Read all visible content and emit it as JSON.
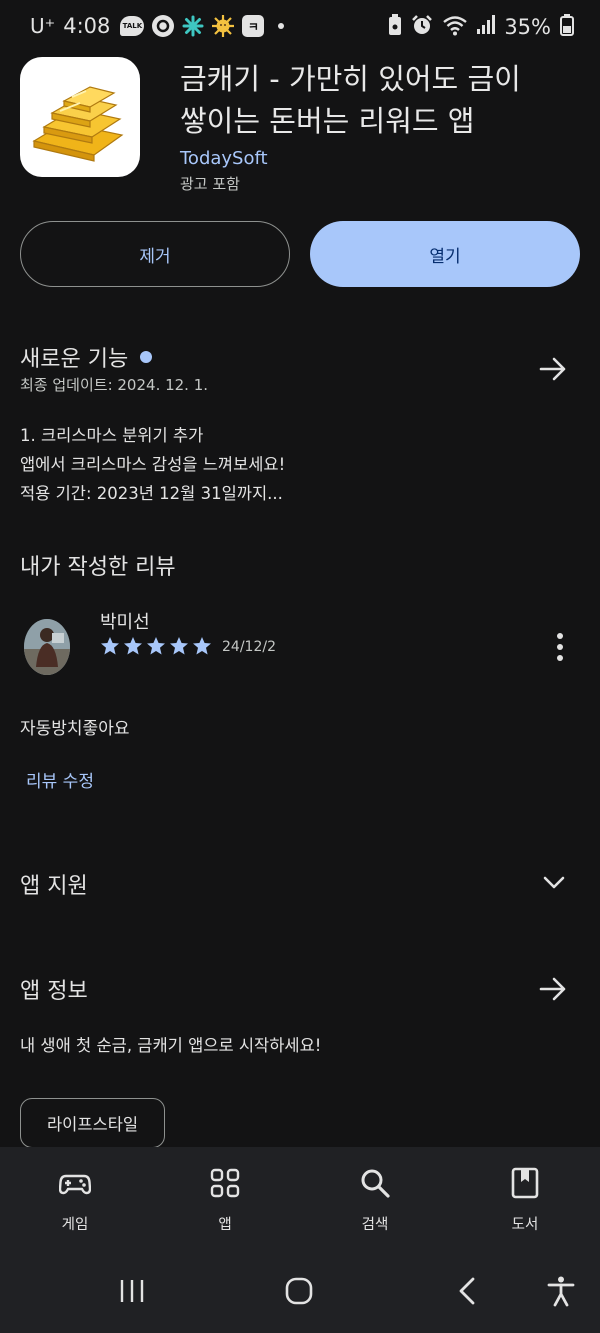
{
  "status_bar": {
    "carrier": "U⁺",
    "time": "4:08",
    "battery": "35%",
    "notification_icons": [
      "talk-icon",
      "q-app-icon",
      "teal-star-icon",
      "sun-face-icon",
      "k-app-icon",
      "dot-icon"
    ],
    "system_icons": [
      "lock-battery-icon",
      "alarm-icon",
      "wifi-icon",
      "signal-icon",
      "battery-icon"
    ]
  },
  "app": {
    "title_line1": "금캐기 - 가만히 있어도 금이",
    "title_line2": "쌓이는 돈버는 리워드 앱",
    "developer": "TodaySoft",
    "ads_label": "광고 포함",
    "icon": "gold-bars-icon"
  },
  "actions": {
    "remove_label": "제거",
    "open_label": "열기"
  },
  "whats_new": {
    "title": "새로운 기능",
    "updated": "최종 업데이트: 2024. 12. 1.",
    "notes": [
      "1. 크리스마스 분위기 추가",
      "앱에서 크리스마스 감성을 느껴보세요!",
      "적용 기간: 2023년 12월 31일까지..."
    ]
  },
  "my_review": {
    "title": "내가 작성한 리뷰",
    "reviewer": "박미선",
    "rating": 5,
    "date": "24/12/2",
    "text": "자동방치좋아요",
    "edit_label": "리뷰 수정"
  },
  "app_support": {
    "title": "앱 지원"
  },
  "about": {
    "title": "앱 정보",
    "description": "내 생애 첫 순금, 금캐기 앱으로 시작하세요!",
    "category_chip": "라이프스타일"
  },
  "bottom_nav": {
    "items": [
      {
        "label": "게임",
        "icon": "gamepad-icon"
      },
      {
        "label": "앱",
        "icon": "apps-grid-icon"
      },
      {
        "label": "검색",
        "icon": "search-icon"
      },
      {
        "label": "도서",
        "icon": "book-icon"
      }
    ]
  },
  "system_nav": [
    "recents-icon",
    "home-icon",
    "back-icon",
    "accessibility-icon"
  ],
  "colors": {
    "background": "#131314",
    "accent": "#a8c7fa",
    "nav_background": "#202124"
  }
}
